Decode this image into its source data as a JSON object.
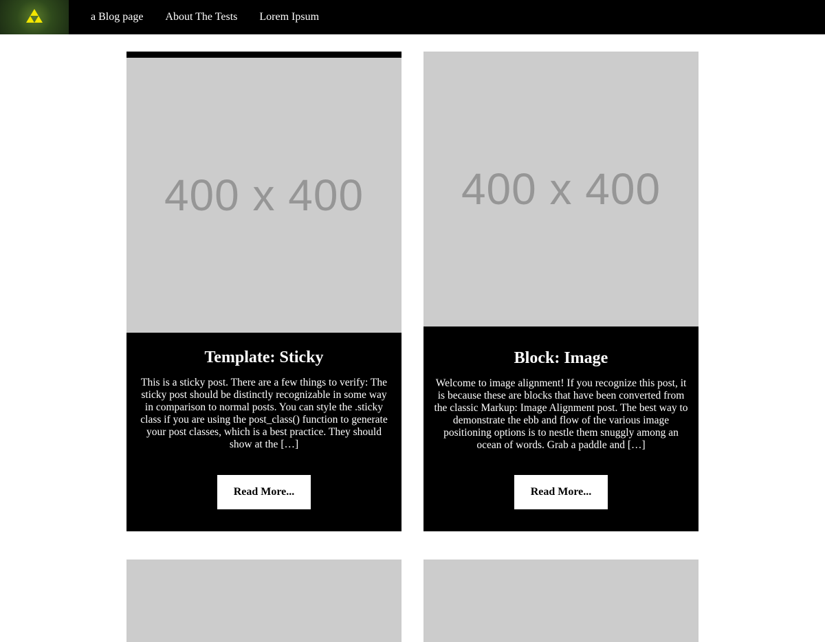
{
  "colors": {
    "nav_bg": "#000000",
    "card_bg": "#000000",
    "placeholder_bg": "#cccccc",
    "placeholder_text": "#969696",
    "logo_accent": "#f2e600"
  },
  "header": {
    "logo_icon": "triforce-icon",
    "nav": [
      {
        "label": "a Blog page"
      },
      {
        "label": "About The Tests"
      },
      {
        "label": "Lorem Ipsum"
      }
    ]
  },
  "posts": [
    {
      "thumbnail_text": "400 x 400",
      "title": "Template: Sticky",
      "excerpt": "This is a sticky post. There are a few things to verify: The sticky post should be distinctly recognizable in some way in comparison to normal posts. You can style the .sticky class if you are using the post_class() function to generate your post classes, which is a best practice. They should show at the […]",
      "button": "Read More..."
    },
    {
      "thumbnail_text": "400 x 400",
      "title": "Block: Image",
      "excerpt": "Welcome to image alignment! If you recognize this post, it is because these are blocks that have been converted from the classic Markup: Image Alignment post. The best way to demonstrate the ebb and flow of the various image positioning options is to nestle them snuggly among an ocean of words. Grab a paddle and […]",
      "button": "Read More..."
    }
  ]
}
